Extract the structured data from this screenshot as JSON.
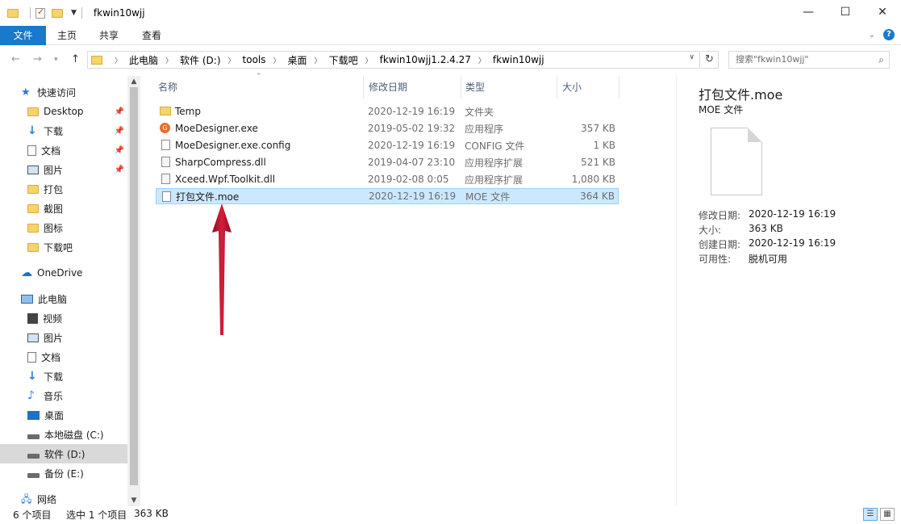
{
  "window": {
    "title": "fkwin10wjj",
    "controls": [
      "minimize",
      "maximize",
      "close"
    ]
  },
  "ribbon": {
    "tabs": [
      "文件",
      "主页",
      "共享",
      "查看"
    ]
  },
  "address": {
    "crumbs": [
      "此电脑",
      "软件 (D:)",
      "tools",
      "桌面",
      "下载吧",
      "fkwin10wjj1.2.4.27",
      "fkwin10wjj"
    ],
    "search_placeholder": "搜索\"fkwin10wjj\""
  },
  "nav": {
    "quick_access": "快速访问",
    "quick_items": [
      {
        "label": "Desktop",
        "icon": "folder-icon",
        "pinned": true
      },
      {
        "label": "下载",
        "icon": "download-icon",
        "pinned": true
      },
      {
        "label": "文档",
        "icon": "document-icon",
        "pinned": true
      },
      {
        "label": "图片",
        "icon": "picture-icon",
        "pinned": true
      },
      {
        "label": "打包",
        "icon": "folder-icon",
        "pinned": false
      },
      {
        "label": "截图",
        "icon": "folder-icon",
        "pinned": false
      },
      {
        "label": "图标",
        "icon": "folder-icon",
        "pinned": false
      },
      {
        "label": "下载吧",
        "icon": "folder-icon",
        "pinned": false
      }
    ],
    "onedrive": "OneDrive",
    "this_pc": "此电脑",
    "pc_items": [
      {
        "label": "视频",
        "icon": "video-icon"
      },
      {
        "label": "图片",
        "icon": "picture-icon"
      },
      {
        "label": "文档",
        "icon": "document-icon"
      },
      {
        "label": "下载",
        "icon": "download-icon"
      },
      {
        "label": "音乐",
        "icon": "music-icon"
      },
      {
        "label": "桌面",
        "icon": "desktop-icon"
      },
      {
        "label": "本地磁盘 (C:)",
        "icon": "drive-icon"
      },
      {
        "label": "软件 (D:)",
        "icon": "drive-icon",
        "selected": true
      },
      {
        "label": "备份 (E:)",
        "icon": "drive-icon"
      }
    ],
    "network": "网络"
  },
  "columns": {
    "name": "名称",
    "date": "修改日期",
    "type": "类型",
    "size": "大小"
  },
  "files": [
    {
      "name": "Temp",
      "date": "2020-12-19 16:19",
      "type": "文件夹",
      "size": "",
      "icon": "folder-icon"
    },
    {
      "name": "MoeDesigner.exe",
      "date": "2019-05-02 19:32",
      "type": "应用程序",
      "size": "357 KB",
      "icon": "app-icon"
    },
    {
      "name": "MoeDesigner.exe.config",
      "date": "2020-12-19 16:19",
      "type": "CONFIG 文件",
      "size": "1 KB",
      "icon": "file-icon"
    },
    {
      "name": "SharpCompress.dll",
      "date": "2019-04-07 23:10",
      "type": "应用程序扩展",
      "size": "521 KB",
      "icon": "dll-icon"
    },
    {
      "name": "Xceed.Wpf.Toolkit.dll",
      "date": "2019-02-08 0:05",
      "type": "应用程序扩展",
      "size": "1,080 KB",
      "icon": "dll-icon"
    },
    {
      "name": "打包文件.moe",
      "date": "2020-12-19 16:19",
      "type": "MOE 文件",
      "size": "364 KB",
      "icon": "file-icon",
      "selected": true
    }
  ],
  "preview": {
    "title": "打包文件.moe",
    "subtitle": "MOE 文件",
    "props": [
      {
        "label": "修改日期:",
        "value": "2020-12-19 16:19"
      },
      {
        "label": "大小:",
        "value": "363 KB"
      },
      {
        "label": "创建日期:",
        "value": "2020-12-19 16:19"
      },
      {
        "label": "可用性:",
        "value": "脱机可用"
      }
    ]
  },
  "status": {
    "count": "6 个项目",
    "selection": "选中 1 个项目",
    "selection_size": "363 KB"
  },
  "colors": {
    "accent": "#1979ca",
    "selection": "#cce8ff",
    "arrow": "#c8102e"
  }
}
